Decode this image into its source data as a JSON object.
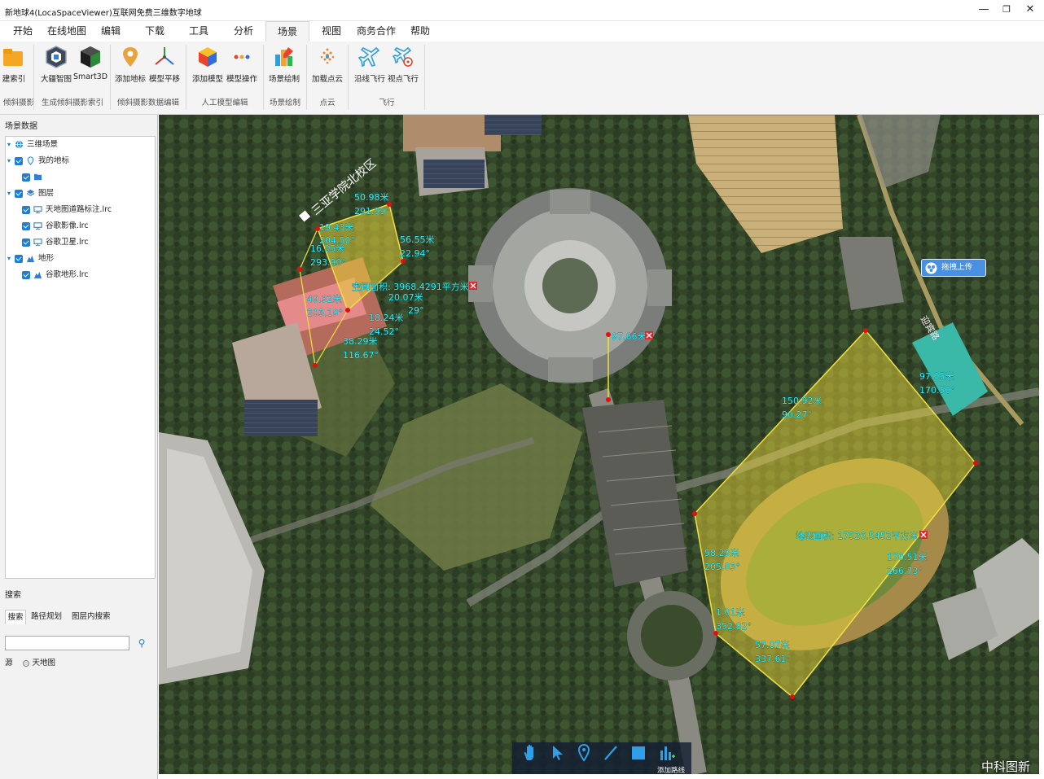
{
  "window": {
    "title": "新地球4(LocaSpaceViewer)互联网免费三维数字地球",
    "minimize": "—",
    "maximize": "❐",
    "close": "✕"
  },
  "menu": {
    "items": [
      "开始",
      "在线地图",
      "编辑",
      "下载",
      "工具",
      "分析",
      "场景",
      "视图",
      "商务合作",
      "帮助"
    ],
    "active": "场景"
  },
  "ribbon": {
    "buttons": [
      {
        "label": "建索引",
        "icon": "folder-icon"
      },
      {
        "label": "大疆智图",
        "icon": "dji-terra-icon"
      },
      {
        "label": "Smart3D",
        "icon": "smart3d-icon"
      },
      {
        "label": "添加地标",
        "icon": "placemark-icon"
      },
      {
        "label": "模型平移",
        "icon": "axis-move-icon"
      },
      {
        "label": "添加模型",
        "icon": "cube-icon"
      },
      {
        "label": "模型操作",
        "icon": "dots-icon"
      },
      {
        "label": "场景绘制",
        "icon": "scene-draw-icon"
      },
      {
        "label": "加载点云",
        "icon": "point-cloud-icon"
      },
      {
        "label": "沿线飞行",
        "icon": "plane-icon"
      },
      {
        "label": "视点飞行",
        "icon": "viewpoint-flight-icon"
      }
    ],
    "groups": [
      "倾斜摄影",
      "生成倾斜摄影索引",
      "倾斜摄影数据编辑",
      "人工模型编辑",
      "场景绘制",
      "点云",
      "飞行"
    ]
  },
  "left_panel": {
    "title": "场景数据",
    "tree": [
      {
        "label": "三维场景",
        "icon": "globe-icon",
        "level": 0
      },
      {
        "label": "我的地标",
        "icon": "placemark-icon",
        "level": 1
      },
      {
        "label": "",
        "icon": "folder-icon",
        "level": 2
      },
      {
        "label": "图层",
        "icon": "layers-icon",
        "level": 1
      },
      {
        "label": "天地图道路标注.lrc",
        "icon": "monitor-icon",
        "level": 2
      },
      {
        "label": "谷歌影像.lrc",
        "icon": "monitor-icon",
        "level": 2
      },
      {
        "label": "谷歌卫星.lrc",
        "icon": "monitor-icon",
        "level": 2
      },
      {
        "label": "地形",
        "icon": "terrain-icon",
        "level": 1
      },
      {
        "label": "谷歌地形.lrc",
        "icon": "terrain-icon",
        "level": 2
      }
    ],
    "search_title": "搜索",
    "search_tabs": [
      "搜索",
      "路径规划",
      "图层内搜索"
    ],
    "search_value": "",
    "source_label": "源",
    "source_option": "天地图"
  },
  "map": {
    "campus_label": "三亚学院北校区",
    "measurements": [
      {
        "text": "50.98米"
      },
      {
        "text": "291.99°"
      },
      {
        "text": "19.43米"
      },
      {
        "text": "204.50°"
      },
      {
        "text": "16.05米"
      },
      {
        "text": "293.90°"
      },
      {
        "text": "56.55米"
      },
      {
        "text": "22.94°"
      },
      {
        "text": "空间面积: 3968.4291平方米"
      },
      {
        "text": "20.07米"
      },
      {
        "text": "29°"
      },
      {
        "text": "49.32米"
      },
      {
        "text": "203.19°"
      },
      {
        "text": "18.24米"
      },
      {
        "text": "24.52°"
      },
      {
        "text": "38.29米"
      },
      {
        "text": "116.67°"
      },
      {
        "text": "97.66米"
      },
      {
        "text": "97.05米"
      },
      {
        "text": "170.50°"
      },
      {
        "text": "150.92米"
      },
      {
        "text": "90.27°"
      },
      {
        "text": "地表面积: 17526.5452平方米"
      },
      {
        "text": "58.29米"
      },
      {
        "text": "205.83°"
      },
      {
        "text": "170.51米"
      },
      {
        "text": "266.73°"
      },
      {
        "text": "1.01米"
      },
      {
        "text": "352.82°"
      },
      {
        "text": "57.07米"
      },
      {
        "text": "337.61°"
      }
    ],
    "road_label": "迎宾路",
    "drag_upload_label": "拖拽上传",
    "toolbar_label": "添加路线",
    "watermark": "中科图新",
    "colors": {
      "measure_text": "#2ff0ff",
      "polygon_fill": "#e6d13a",
      "polygon_stroke": "#f0e040",
      "vertex": "#e01010",
      "delete_icon": "#e0262b"
    }
  }
}
